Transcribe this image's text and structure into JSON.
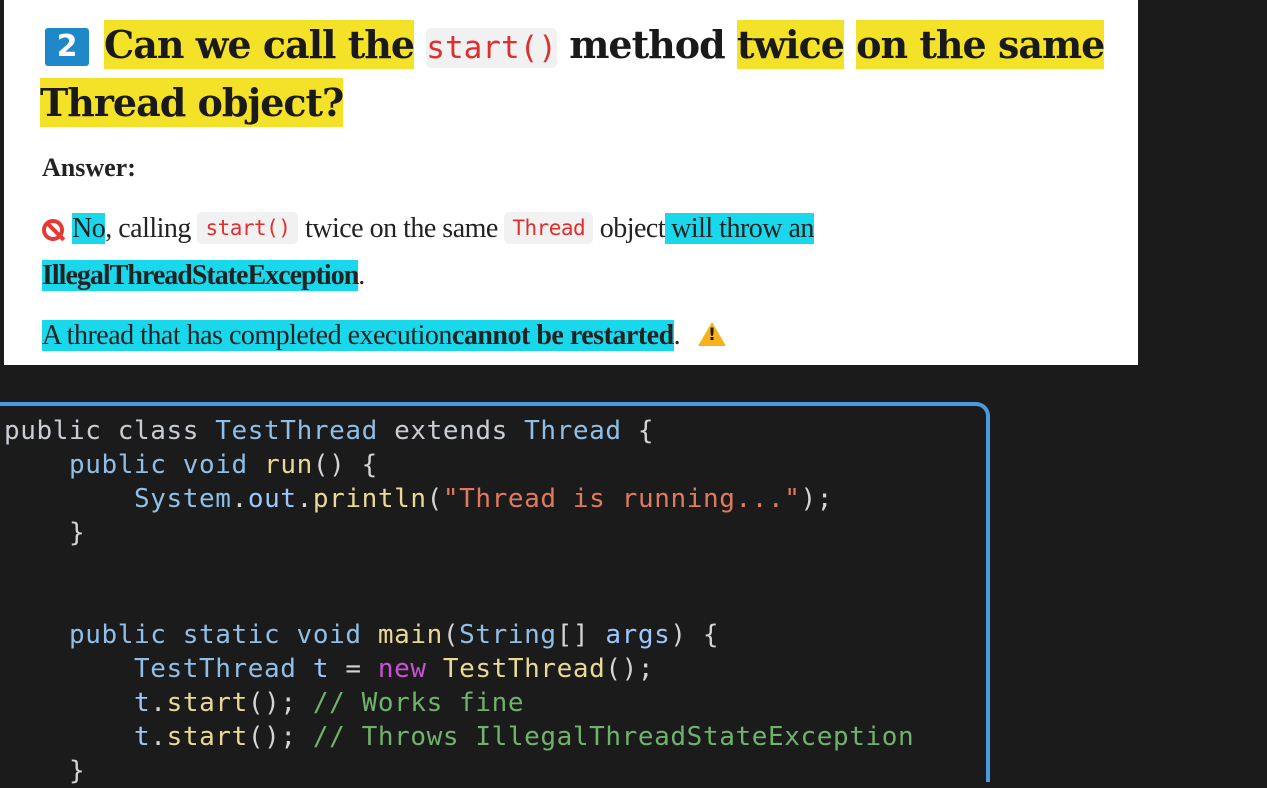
{
  "question": {
    "number": "2",
    "line1_a": "Can we call the",
    "code": "start()",
    "line1_b": "method",
    "line1_c": "twice",
    "line1_d": "on the same",
    "line2": "Thread object?"
  },
  "answer": {
    "label": "Answer:",
    "no": "No",
    "p1_a": ", calling",
    "p1_code1": "start()",
    "p1_b": "twice on the same",
    "p1_code2": "Thread",
    "p1_c": "object",
    "p1_d": "will throw an",
    "exception": "IllegalThreadStateException",
    "p1_end": ".",
    "p2_a": "A thread that has completed execution",
    "p2_b": "cannot be restarted",
    "p2_end": "."
  },
  "code": {
    "l1": {
      "a": "public class ",
      "b": "TestThread",
      "c": " extends ",
      "d": "Thread",
      "e": " {"
    },
    "l2": {
      "a": "    public void ",
      "b": "run",
      "c": "() {"
    },
    "l3": {
      "a": "        ",
      "b": "System",
      "c": ".",
      "d": "out",
      "e": ".",
      "f": "println",
      "g": "(",
      "h": "\"Thread is running...\"",
      "i": ");"
    },
    "l4": {
      "a": "    }"
    },
    "l7": {
      "a": "    public static void ",
      "b": "main",
      "c": "(",
      "d": "String",
      "e": "[] ",
      "f": "args",
      "g": ") {"
    },
    "l8": {
      "a": "        ",
      "b": "TestThread",
      "c": " t",
      "d": " = ",
      "e": "new",
      "f": " TestThread",
      "g": "();"
    },
    "l9": {
      "a": "        ",
      "b": "t",
      "c": ".",
      "d": "start",
      "e": "(); ",
      "f": "// Works fine"
    },
    "l10": {
      "a": "        ",
      "b": "t",
      "c": ".",
      "d": "start",
      "e": "(); ",
      "f": "// Throws IllegalThreadStateException"
    },
    "l11": {
      "a": "    }"
    }
  },
  "colors": {
    "highlight_yellow": "#f4e228",
    "highlight_cyan": "#19d8ec",
    "badge_blue": "#1e88c8",
    "frame_blue": "#4a9ae0",
    "code_bg": "#1b1b1c"
  }
}
